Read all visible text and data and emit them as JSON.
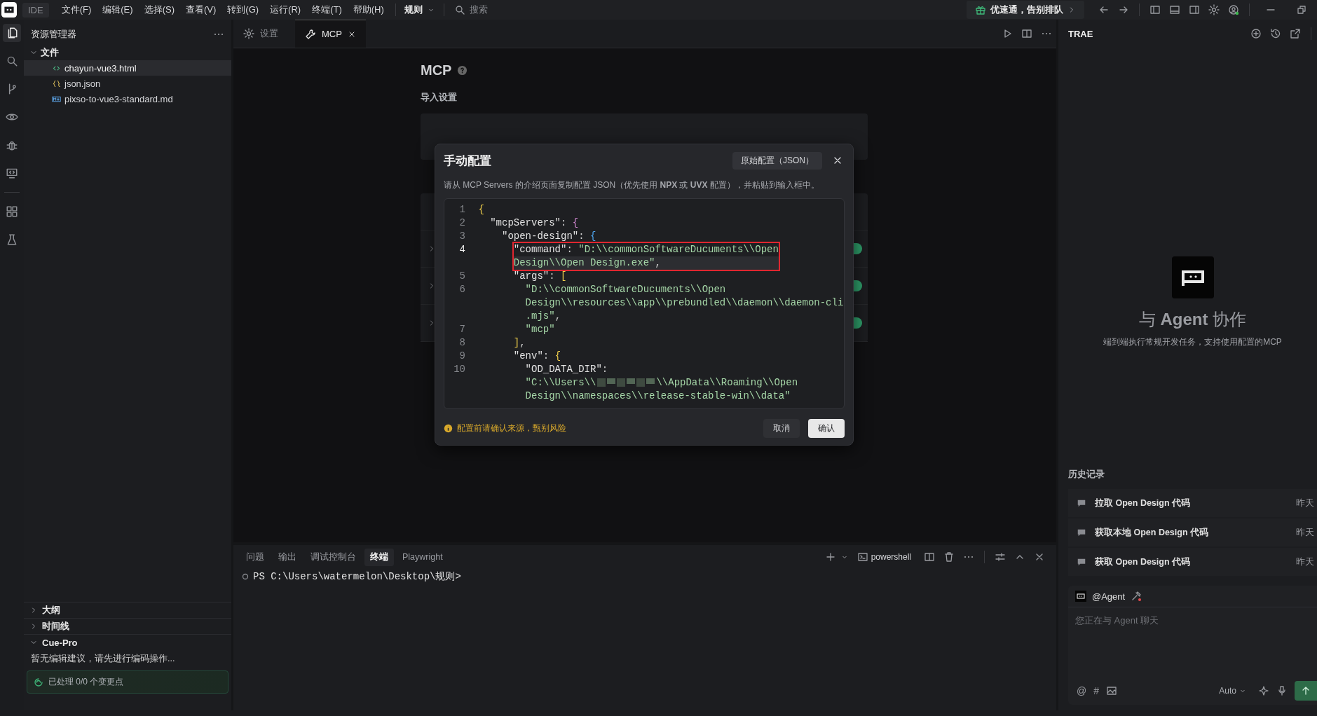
{
  "titlebar": {
    "app": "IDE",
    "menu": [
      "文件(F)",
      "编辑(E)",
      "选择(S)",
      "查看(V)",
      "转到(G)",
      "运行(R)",
      "终端(T)",
      "帮助(H)"
    ],
    "rules": "规则",
    "search": "搜索",
    "promo": "优速通，告别排队"
  },
  "activity": [
    {
      "kind": "files",
      "selected": true
    },
    {
      "kind": "search",
      "selected": false
    },
    {
      "kind": "branch",
      "selected": false
    },
    {
      "kind": "eye",
      "selected": false
    },
    {
      "kind": "bug",
      "selected": false
    },
    {
      "kind": "remote",
      "selected": false
    },
    {
      "kind": "grid",
      "selected": false
    },
    {
      "kind": "flask",
      "selected": false
    }
  ],
  "explorer": {
    "title": "资源管理器",
    "tree": [
      {
        "label": "文件",
        "expanded": true,
        "children": [
          {
            "label": "chayun-vue3.html",
            "kind": "html",
            "selected": true
          },
          {
            "label": "json.json",
            "kind": "json",
            "selected": false
          },
          {
            "label": "pixso-to-vue3-standard.md",
            "kind": "md",
            "selected": false
          }
        ]
      }
    ],
    "panels": [
      {
        "title": "大纲",
        "expanded": false
      },
      {
        "title": "时间线",
        "expanded": false
      },
      {
        "title": "Cue-Pro",
        "expanded": true,
        "message": "暂无编辑建议，请先进行编码操作...",
        "status": "已处理 0/0 个变更点"
      }
    ]
  },
  "editor_tabs": [
    {
      "label": "设置",
      "kind": "settings",
      "selected": false,
      "closable": false
    },
    {
      "label": "MCP",
      "kind": "mcp",
      "selected": true,
      "closable": true
    }
  ],
  "mcp_page": {
    "title": "MCP",
    "section": "导入设置",
    "server_rows": [
      {
        "enabled": true
      },
      {
        "enabled": true
      },
      {
        "enabled": true
      }
    ]
  },
  "dialog": {
    "title": "手动配置",
    "raw_button": "原始配置（JSON）",
    "description": "请从 MCP Servers 的介绍页面复制配置 JSON（优先使用 **NPX** 或 **UVX** 配置），并粘贴到输入框中。",
    "code": [
      {
        "number": "1",
        "current": false,
        "marked": false,
        "rows": [
          {
            "tokens": [
              {
                "kind": "bracket1",
                "text": "{"
              }
            ]
          }
        ],
        "children": [
          {
            "number": "2",
            "current": false,
            "marked": false,
            "rows": [
              {
                "tokens": [
                  {
                    "kind": "key",
                    "text": "\"mcpServers\""
                  },
                  {
                    "kind": "punct",
                    "text": ": "
                  },
                  {
                    "kind": "bracket2",
                    "text": "{"
                  }
                ]
              }
            ],
            "children": [
              {
                "number": "3",
                "current": false,
                "marked": false,
                "rows": [
                  {
                    "tokens": [
                      {
                        "kind": "key",
                        "text": "\"open-design\""
                      },
                      {
                        "kind": "punct",
                        "text": ": "
                      },
                      {
                        "kind": "bracket3",
                        "text": "{"
                      }
                    ]
                  }
                ],
                "children": [
                  {
                    "number": "4",
                    "current": true,
                    "marked": true,
                    "rows": [
                      {
                        "tokens": [
                          {
                            "kind": "key",
                            "text": "\"command\""
                          },
                          {
                            "kind": "punct",
                            "text": ": "
                          },
                          {
                            "kind": "string",
                            "text": "\"D:\\\\commonSoftwareDucuments\\\\Open"
                          }
                        ]
                      },
                      {
                        "tokens": [
                          {
                            "kind": "string",
                            "text": "Design\\\\Open Design.exe\""
                          },
                          {
                            "kind": "punct",
                            "text": ","
                          }
                        ]
                      }
                    ]
                  },
                  {
                    "number": "5",
                    "current": false,
                    "marked": false,
                    "rows": [
                      {
                        "tokens": [
                          {
                            "kind": "key",
                            "text": "\"args\""
                          },
                          {
                            "kind": "punct",
                            "text": ": "
                          },
                          {
                            "kind": "bracket1",
                            "text": "["
                          }
                        ]
                      }
                    ],
                    "children": [
                      {
                        "number": "6",
                        "current": false,
                        "marked": false,
                        "rows": [
                          {
                            "tokens": [
                              {
                                "kind": "string",
                                "text": "\"D:\\\\commonSoftwareDucuments\\\\Open"
                              }
                            ]
                          },
                          {
                            "tokens": [
                              {
                                "kind": "string",
                                "text": "Design\\\\resources\\\\app\\\\prebundled\\\\daemon\\\\daemon-cli"
                              }
                            ]
                          },
                          {
                            "tokens": [
                              {
                                "kind": "string",
                                "text": ".mjs\""
                              },
                              {
                                "kind": "punct",
                                "text": ","
                              }
                            ]
                          }
                        ]
                      },
                      {
                        "number": "7",
                        "current": false,
                        "marked": false,
                        "rows": [
                          {
                            "tokens": [
                              {
                                "kind": "string",
                                "text": "\"mcp\""
                              }
                            ]
                          }
                        ]
                      }
                    ]
                  },
                  {
                    "number": "8",
                    "current": false,
                    "marked": false,
                    "rows": [
                      {
                        "tokens": [
                          {
                            "kind": "bracket1",
                            "text": "]"
                          },
                          {
                            "kind": "punct",
                            "text": ","
                          }
                        ]
                      }
                    ]
                  },
                  {
                    "number": "9",
                    "current": false,
                    "marked": false,
                    "rows": [
                      {
                        "tokens": [
                          {
                            "kind": "key",
                            "text": "\"env\""
                          },
                          {
                            "kind": "punct",
                            "text": ": "
                          },
                          {
                            "kind": "bracket1",
                            "text": "{"
                          }
                        ]
                      }
                    ],
                    "children": [
                      {
                        "number": "10",
                        "current": false,
                        "marked": false,
                        "rows": [
                          {
                            "tokens": [
                              {
                                "kind": "key",
                                "text": "\"OD_DATA_DIR\""
                              },
                              {
                                "kind": "punct",
                                "text": ":"
                              }
                            ]
                          },
                          {
                            "tokens": [
                              {
                                "kind": "string",
                                "text": "\"C:\\\\Users\\\\"
                              },
                              {
                                "kind": "redacted"
                              },
                              {
                                "kind": "string",
                                "text": "\\\\AppData\\\\Roaming\\\\Open"
                              }
                            ]
                          },
                          {
                            "tokens": [
                              {
                                "kind": "string",
                                "text": "Design\\\\namespaces\\\\release-stable-win\\\\data\""
                              }
                            ]
                          }
                        ]
                      }
                    ]
                  }
                ]
              }
            ]
          }
        ]
      }
    ],
    "warning": "配置前请确认来源，甄别风险",
    "buttons": [
      {
        "label": "取消",
        "primary": false
      },
      {
        "label": "确认",
        "primary": true
      }
    ]
  },
  "bottom_panel": {
    "tabs": [
      {
        "label": "问题",
        "selected": false
      },
      {
        "label": "输出",
        "selected": false
      },
      {
        "label": "调试控制台",
        "selected": false
      },
      {
        "label": "终端",
        "selected": true
      },
      {
        "label": "Playwright",
        "selected": false
      }
    ],
    "shell": "powershell",
    "prompt": "PS C:\\Users\\watermelon\\Desktop\\规则>"
  },
  "agent_panel": {
    "title": "TRAE",
    "heading": "与 **Agent** 协作",
    "subtitle": "端到端执行常规开发任务，支持使用配置的MCP",
    "history_title": "历史记录",
    "history": [
      {
        "title": "拉取 Open Design 代码",
        "time": "昨天"
      },
      {
        "title": "获取本地 Open Design 代码",
        "time": "昨天"
      },
      {
        "title": "获取 Open Design 代码",
        "time": "昨天"
      }
    ],
    "chat": {
      "agent": "@Agent",
      "placeholder": "您正在与 Agent 聊天",
      "tools": [
        "@",
        "#"
      ],
      "mode": "Auto"
    }
  }
}
